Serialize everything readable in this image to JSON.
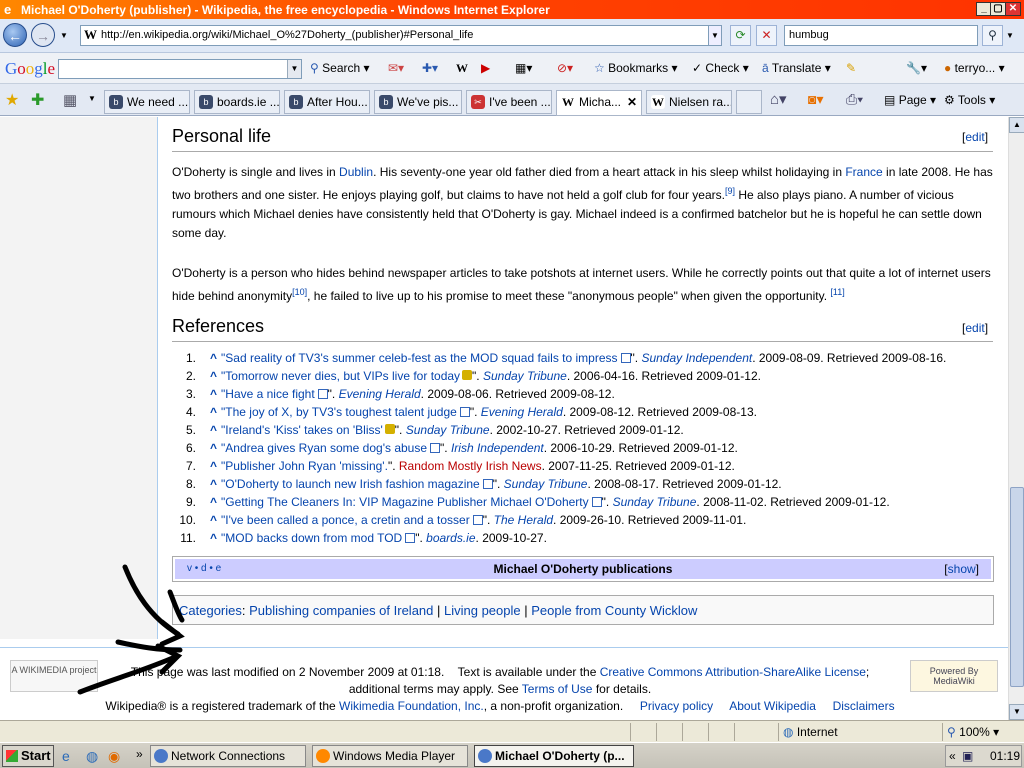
{
  "window": {
    "title": "Michael O'Doherty (publisher) - Wikipedia, the free encyclopedia - Windows Internet Explorer"
  },
  "address": {
    "url": "http://en.wikipedia.org/wiki/Michael_O%27Doherty_(publisher)#Personal_life",
    "search": "humbug"
  },
  "googlebar": {
    "logo": "Google",
    "search": "Search",
    "bookmarks": "Bookmarks",
    "check": "Check",
    "translate": "Translate",
    "user": "terryo..."
  },
  "tabs": [
    "We need ...",
    "boards.ie ...",
    "After Hou...",
    "We've pis...",
    "I've been ...",
    "Micha...",
    "Nielsen ra..."
  ],
  "cmdbar": {
    "page": "Page",
    "tools": "Tools"
  },
  "article": {
    "personal_life": {
      "heading": "Personal life",
      "edit": "edit",
      "p1_a": "O'Doherty is single and lives in ",
      "p1_dublin": "Dublin",
      "p1_b": ". His seventy-one year old father died from a heart attack in his sleep whilst holidaying in ",
      "p1_france": "France",
      "p1_c": " in late 2008. He has two brothers and one sister. He enjoys playing golf, but claims to have not held a golf club for four years.",
      "p1_ref": "[9]",
      "p1_d": " He also plays piano. A number of vicious rumours which Michael denies have consistently held that O'Doherty is gay. Michael indeed is a confirmed batchelor but he is hopeful he can settle down some day.",
      "p2_a": "O'Doherty is a person who hides behind newspaper articles to take potshots at internet users. While he correctly points out that quite a lot of internet users hide behind anonymity",
      "p2_ref1": "[10]",
      "p2_b": ", he failed to live up to his promise to meet these \"anonymous people\" when given the opportunity. ",
      "p2_ref2": "[11]"
    },
    "references": {
      "heading": "References",
      "edit": "edit",
      "items": [
        {
          "num": "1.",
          "title": "\"Sad reality of TV3's summer celeb-fest as the MOD squad fails to impress",
          "src": "Sunday Independent",
          "rest": ". 2009-08-09. Retrieved 2009-08-16."
        },
        {
          "num": "2.",
          "title": "\"Tomorrow never dies, but VIPs live for today",
          "src": "Sunday Tribune",
          "rest": ". 2006-04-16. Retrieved 2009-01-12."
        },
        {
          "num": "3.",
          "title": "\"Have a nice fight",
          "src": "Evening Herald",
          "rest": ". 2009-08-06. Retrieved 2009-08-12."
        },
        {
          "num": "4.",
          "title": "\"The joy of X, by TV3's toughest talent judge",
          "src": "Evening Herald",
          "rest": ". 2009-08-12. Retrieved 2009-08-13."
        },
        {
          "num": "5.",
          "title": "\"Ireland's 'Kiss' takes on 'Bliss'",
          "src": "Sunday Tribune",
          "rest": ". 2002-10-27. Retrieved 2009-01-12."
        },
        {
          "num": "6.",
          "title": "\"Andrea gives Ryan some dog's abuse",
          "src": "Irish Independent",
          "rest": ". 2006-10-29. Retrieved 2009-01-12."
        },
        {
          "num": "7.",
          "title": "\"Publisher John Ryan 'missing'.",
          "src": "Random Mostly Irish News",
          "rest": ". 2007-11-25. Retrieved 2009-01-12."
        },
        {
          "num": "8.",
          "title": "\"O'Doherty to launch new Irish fashion magazine",
          "src": "Sunday Tribune",
          "rest": ". 2008-08-17. Retrieved 2009-01-12."
        },
        {
          "num": "9.",
          "title": "\"Getting The Cleaners In: VIP Magazine Publisher Michael O'Doherty",
          "src": "Sunday Tribune",
          "rest": ". 2008-11-02. Retrieved 2009-01-12."
        },
        {
          "num": "10.",
          "title": "\"I've been called a ponce, a cretin and a tosser",
          "src": "The Herald",
          "rest": ". 2009-26-10. Retrieved 2009-11-01."
        },
        {
          "num": "11.",
          "title": "\"MOD backs down from mod TOD",
          "src": "boards.ie",
          "rest": ". 2009-10-27."
        }
      ]
    },
    "navbox": {
      "vde": "v • d • e",
      "title": "Michael O'Doherty publications",
      "show": "show"
    },
    "categories": {
      "label": "Categories",
      "items": [
        "Publishing companies of Ireland",
        "Living people",
        "People from County Wicklow"
      ]
    }
  },
  "footer": {
    "wikimedia": "A WIKIMEDIA project",
    "mediawiki": "Powered By MediaWiki",
    "line1_a": "This page was last modified on 2 November 2009 at 01:18.",
    "line1_b": "Text is available under the ",
    "license": "Creative Commons Attribution-ShareAlike License",
    "line1_c": ";",
    "line2_a": "additional terms may apply. See ",
    "terms": "Terms of Use",
    "line2_b": " for details.",
    "line3_a": "Wikipedia® is a registered trademark of the ",
    "wmf": "Wikimedia Foundation, Inc.",
    "line3_b": ", a non-profit organization.",
    "privacy": "Privacy policy",
    "about": "About Wikipedia",
    "disclaimers": "Disclaimers"
  },
  "status": {
    "zone": "Internet",
    "zoom": "100%"
  },
  "taskbar": {
    "start": "Start",
    "items": [
      "Network Connections",
      "Windows Media Player",
      "Michael O'Doherty (p..."
    ],
    "clock": "01:19"
  }
}
